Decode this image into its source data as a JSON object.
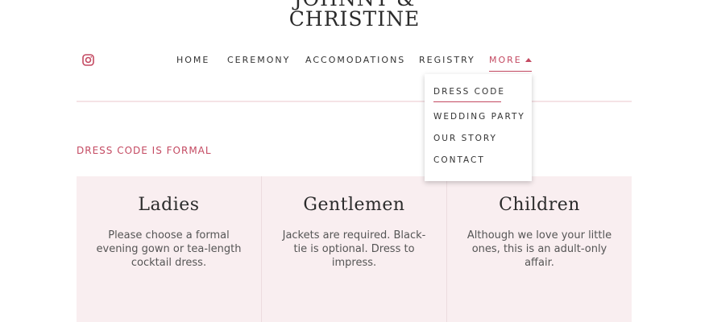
{
  "site": {
    "logo_line1": "JOHNNY &",
    "logo_line2": "CHRISTINE"
  },
  "nav": {
    "items": [
      {
        "label": "HOME"
      },
      {
        "label": "CEREMONY"
      },
      {
        "label": "ACCOMODATIONS"
      },
      {
        "label": "REGISTRY"
      },
      {
        "label": "MORE"
      }
    ],
    "active": "MORE"
  },
  "dropdown": {
    "items": [
      {
        "label": "DRESS CODE"
      },
      {
        "label": "WEDDING PARTY"
      },
      {
        "label": "OUR STORY"
      },
      {
        "label": "CONTACT"
      }
    ],
    "selected": "DRESS CODE"
  },
  "section": {
    "heading": "DRESS CODE IS FORMAL"
  },
  "cards": [
    {
      "title": "Ladies",
      "text": "Please choose a formal evening gown or tea-length cocktail dress."
    },
    {
      "title": "Gentlemen",
      "text": "Jackets are required. Black-tie is optional. Dress to impress."
    },
    {
      "title": "Children",
      "text": "Although we love your little ones, this is an adult-only affair."
    }
  ],
  "colors": {
    "accent": "#c44a62",
    "card_background": "#f9eef0",
    "divider": "#f5e3e6"
  },
  "icons": {
    "social": "instagram-icon",
    "more_caret": "caret-up-icon"
  }
}
